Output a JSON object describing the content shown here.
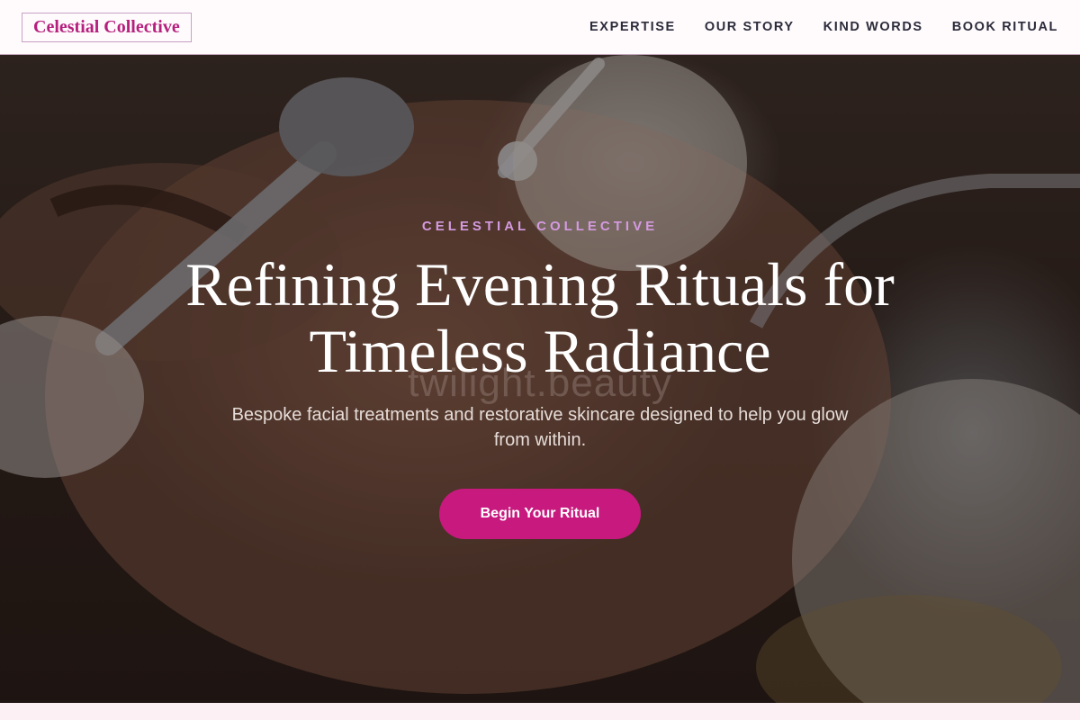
{
  "header": {
    "brand": "Celestial Collective",
    "nav": [
      {
        "label": "EXPERTISE"
      },
      {
        "label": "OUR STORY"
      },
      {
        "label": "KIND WORDS"
      },
      {
        "label": "BOOK RITUAL"
      }
    ]
  },
  "hero": {
    "eyebrow": "CELESTIAL COLLECTIVE",
    "headline": "Refining Evening Rituals for Timeless Radiance",
    "watermark": "twilight.beauty",
    "subtitle": "Bespoke facial treatments and restorative skincare designed to help you glow from within.",
    "cta_label": "Begin Your Ritual"
  },
  "colors": {
    "accent": "#c8197f",
    "brand_text": "#b5207d",
    "eyebrow": "#d49ae0",
    "nav_text": "#2b2b3a"
  }
}
